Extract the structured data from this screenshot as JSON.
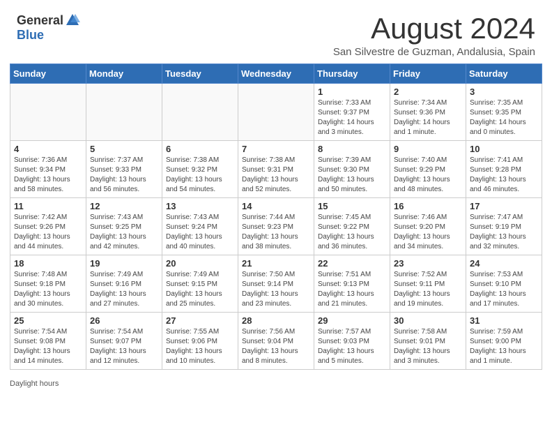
{
  "header": {
    "logo_general": "General",
    "logo_blue": "Blue",
    "month_year": "August 2024",
    "location": "San Silvestre de Guzman, Andalusia, Spain"
  },
  "days_of_week": [
    "Sunday",
    "Monday",
    "Tuesday",
    "Wednesday",
    "Thursday",
    "Friday",
    "Saturday"
  ],
  "weeks": [
    [
      {
        "day": "",
        "info": ""
      },
      {
        "day": "",
        "info": ""
      },
      {
        "day": "",
        "info": ""
      },
      {
        "day": "",
        "info": ""
      },
      {
        "day": "1",
        "info": "Sunrise: 7:33 AM\nSunset: 9:37 PM\nDaylight: 14 hours\nand 3 minutes."
      },
      {
        "day": "2",
        "info": "Sunrise: 7:34 AM\nSunset: 9:36 PM\nDaylight: 14 hours\nand 1 minute."
      },
      {
        "day": "3",
        "info": "Sunrise: 7:35 AM\nSunset: 9:35 PM\nDaylight: 14 hours\nand 0 minutes."
      }
    ],
    [
      {
        "day": "4",
        "info": "Sunrise: 7:36 AM\nSunset: 9:34 PM\nDaylight: 13 hours\nand 58 minutes."
      },
      {
        "day": "5",
        "info": "Sunrise: 7:37 AM\nSunset: 9:33 PM\nDaylight: 13 hours\nand 56 minutes."
      },
      {
        "day": "6",
        "info": "Sunrise: 7:38 AM\nSunset: 9:32 PM\nDaylight: 13 hours\nand 54 minutes."
      },
      {
        "day": "7",
        "info": "Sunrise: 7:38 AM\nSunset: 9:31 PM\nDaylight: 13 hours\nand 52 minutes."
      },
      {
        "day": "8",
        "info": "Sunrise: 7:39 AM\nSunset: 9:30 PM\nDaylight: 13 hours\nand 50 minutes."
      },
      {
        "day": "9",
        "info": "Sunrise: 7:40 AM\nSunset: 9:29 PM\nDaylight: 13 hours\nand 48 minutes."
      },
      {
        "day": "10",
        "info": "Sunrise: 7:41 AM\nSunset: 9:28 PM\nDaylight: 13 hours\nand 46 minutes."
      }
    ],
    [
      {
        "day": "11",
        "info": "Sunrise: 7:42 AM\nSunset: 9:26 PM\nDaylight: 13 hours\nand 44 minutes."
      },
      {
        "day": "12",
        "info": "Sunrise: 7:43 AM\nSunset: 9:25 PM\nDaylight: 13 hours\nand 42 minutes."
      },
      {
        "day": "13",
        "info": "Sunrise: 7:43 AM\nSunset: 9:24 PM\nDaylight: 13 hours\nand 40 minutes."
      },
      {
        "day": "14",
        "info": "Sunrise: 7:44 AM\nSunset: 9:23 PM\nDaylight: 13 hours\nand 38 minutes."
      },
      {
        "day": "15",
        "info": "Sunrise: 7:45 AM\nSunset: 9:22 PM\nDaylight: 13 hours\nand 36 minutes."
      },
      {
        "day": "16",
        "info": "Sunrise: 7:46 AM\nSunset: 9:20 PM\nDaylight: 13 hours\nand 34 minutes."
      },
      {
        "day": "17",
        "info": "Sunrise: 7:47 AM\nSunset: 9:19 PM\nDaylight: 13 hours\nand 32 minutes."
      }
    ],
    [
      {
        "day": "18",
        "info": "Sunrise: 7:48 AM\nSunset: 9:18 PM\nDaylight: 13 hours\nand 30 minutes."
      },
      {
        "day": "19",
        "info": "Sunrise: 7:49 AM\nSunset: 9:16 PM\nDaylight: 13 hours\nand 27 minutes."
      },
      {
        "day": "20",
        "info": "Sunrise: 7:49 AM\nSunset: 9:15 PM\nDaylight: 13 hours\nand 25 minutes."
      },
      {
        "day": "21",
        "info": "Sunrise: 7:50 AM\nSunset: 9:14 PM\nDaylight: 13 hours\nand 23 minutes."
      },
      {
        "day": "22",
        "info": "Sunrise: 7:51 AM\nSunset: 9:13 PM\nDaylight: 13 hours\nand 21 minutes."
      },
      {
        "day": "23",
        "info": "Sunrise: 7:52 AM\nSunset: 9:11 PM\nDaylight: 13 hours\nand 19 minutes."
      },
      {
        "day": "24",
        "info": "Sunrise: 7:53 AM\nSunset: 9:10 PM\nDaylight: 13 hours\nand 17 minutes."
      }
    ],
    [
      {
        "day": "25",
        "info": "Sunrise: 7:54 AM\nSunset: 9:08 PM\nDaylight: 13 hours\nand 14 minutes."
      },
      {
        "day": "26",
        "info": "Sunrise: 7:54 AM\nSunset: 9:07 PM\nDaylight: 13 hours\nand 12 minutes."
      },
      {
        "day": "27",
        "info": "Sunrise: 7:55 AM\nSunset: 9:06 PM\nDaylight: 13 hours\nand 10 minutes."
      },
      {
        "day": "28",
        "info": "Sunrise: 7:56 AM\nSunset: 9:04 PM\nDaylight: 13 hours\nand 8 minutes."
      },
      {
        "day": "29",
        "info": "Sunrise: 7:57 AM\nSunset: 9:03 PM\nDaylight: 13 hours\nand 5 minutes."
      },
      {
        "day": "30",
        "info": "Sunrise: 7:58 AM\nSunset: 9:01 PM\nDaylight: 13 hours\nand 3 minutes."
      },
      {
        "day": "31",
        "info": "Sunrise: 7:59 AM\nSunset: 9:00 PM\nDaylight: 13 hours\nand 1 minute."
      }
    ]
  ],
  "footer": {
    "note": "Daylight hours"
  }
}
